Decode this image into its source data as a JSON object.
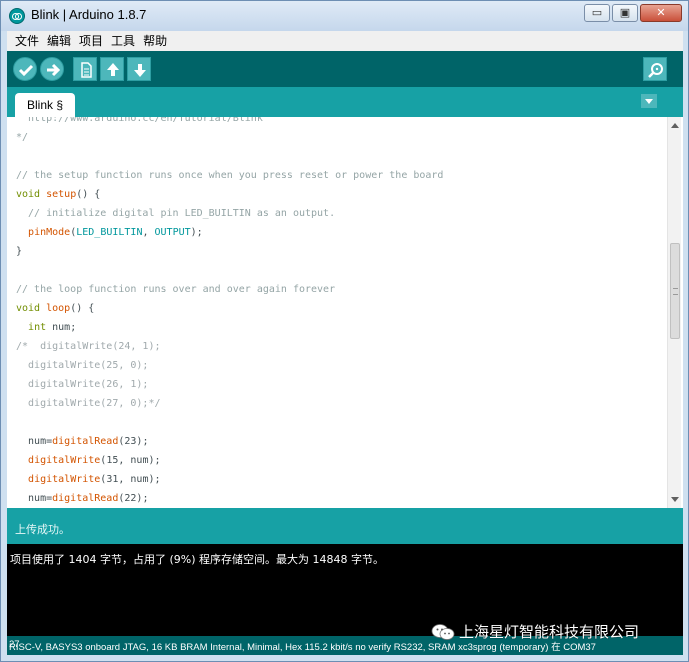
{
  "window": {
    "title": "Blink | Arduino 1.8.7",
    "controls": {
      "minimize": "▭",
      "maximize": "▣",
      "close": "✕"
    }
  },
  "menubar": {
    "items": [
      "文件",
      "编辑",
      "项目",
      "工具",
      "帮助"
    ]
  },
  "toolbar": {
    "buttons": [
      "verify-icon",
      "upload-icon",
      "new-icon",
      "open-icon",
      "save-icon"
    ],
    "right_button": "serial-monitor-icon"
  },
  "tabs": [
    {
      "label": "Blink §"
    }
  ],
  "editor": {
    "lines": [
      "  http://www.arduino.cc/en/Tutorial/Blink",
      "*/",
      "",
      "// the setup function runs once when you press reset or power the board",
      "void setup() {",
      "  // initialize digital pin LED_BUILTIN as an output.",
      "  pinMode(LED_BUILTIN, OUTPUT);",
      "}",
      "",
      "// the loop function runs over and over again forever",
      "void loop() {",
      "  int num;",
      "/*  digitalWrite(24, 1);",
      "  digitalWrite(25, 0);",
      "  digitalWrite(26, 1);",
      "  digitalWrite(27, 0);*/",
      "",
      "  num=digitalRead(23);",
      "  digitalWrite(15, num);",
      "  digitalWrite(31, num);",
      "  num=digitalRead(22);"
    ]
  },
  "status": {
    "message": "上传成功。"
  },
  "console": {
    "line": "项目使用了 1404 字节，占用了 (9%) 程序存储空间。最大为 14848 字节。"
  },
  "footer": {
    "line_number": "27",
    "board_info": "RISC-V, BASYS3 onboard JTAG, 16 KB BRAM Internal, Minimal, Hex 115.2 kbit/s no verify RS232, SRAM xc3sprog (temporary) 在 COM37"
  },
  "watermark": {
    "text": "上海星灯智能科技有限公司"
  },
  "colors": {
    "toolbar": "#006468",
    "tabstrip": "#17a1a5",
    "button": "#4db7bb",
    "keyword": "#728e00",
    "function": "#d35400",
    "constant": "#00979c",
    "comment": "#95a5a6"
  }
}
